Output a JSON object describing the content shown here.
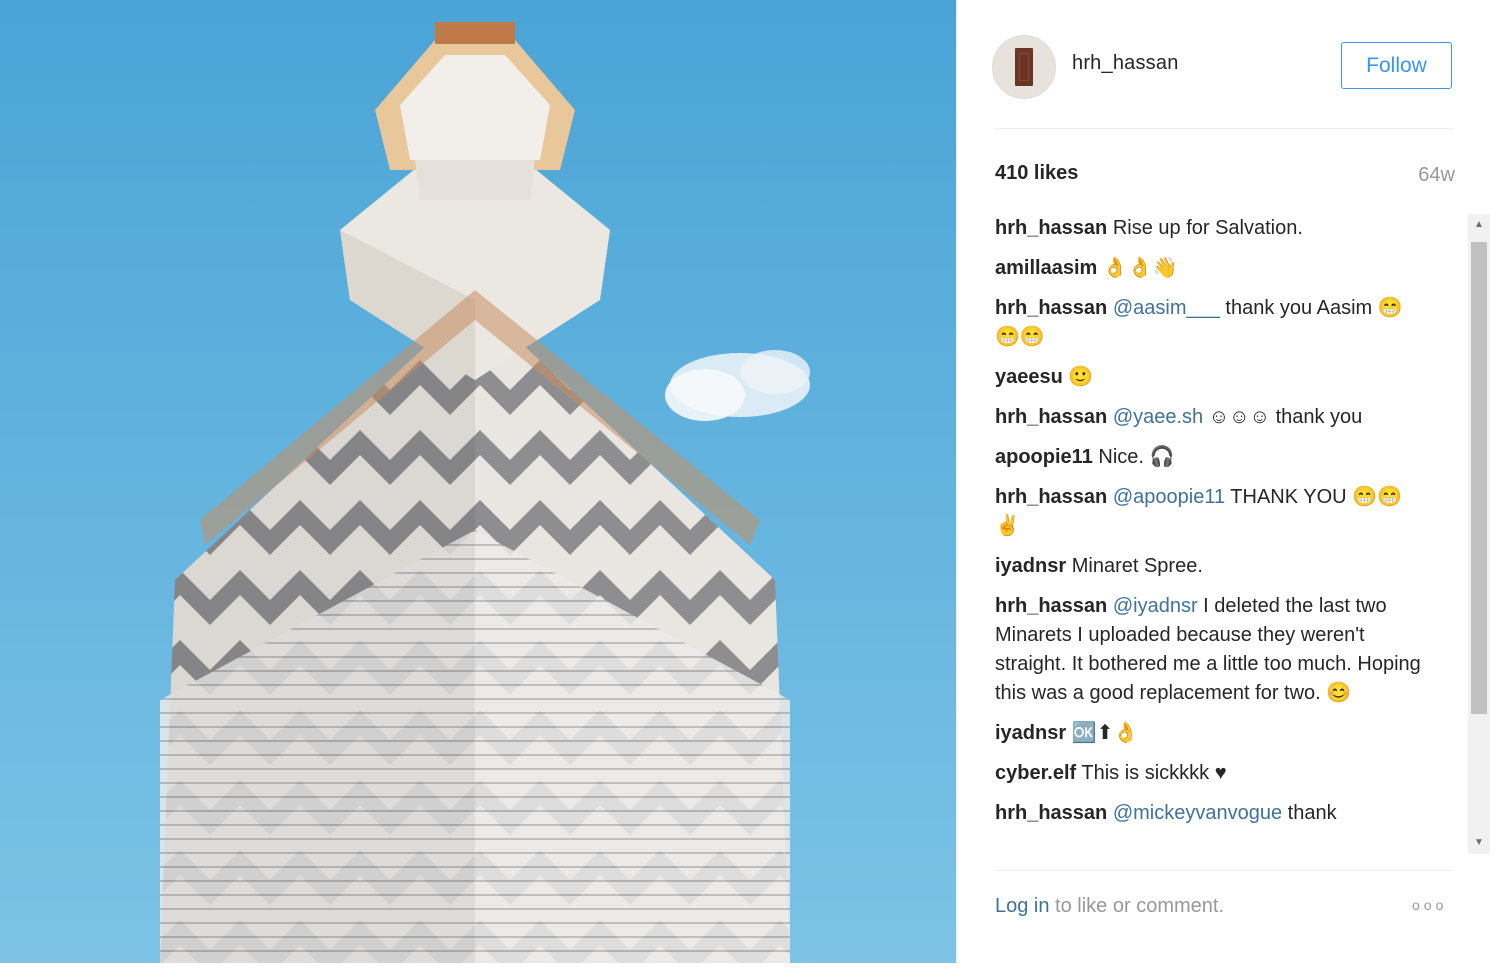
{
  "post": {
    "username": "hrh_hassan",
    "follow_label": "Follow",
    "likes": "410 likes",
    "age": "64w"
  },
  "comments": [
    {
      "user": "hrh_hassan",
      "mention": "",
      "text": "Rise up for Salvation."
    },
    {
      "user": "amillaasim",
      "mention": "",
      "text": "👌👌👋"
    },
    {
      "user": "hrh_hassan",
      "mention": "@aasim___",
      "text": "thank you Aasim 😁😁😁"
    },
    {
      "user": "yaeesu",
      "mention": "",
      "text": "🙂"
    },
    {
      "user": "hrh_hassan",
      "mention": "@yaee.sh",
      "text": "☺☺☺ thank you"
    },
    {
      "user": "apoopie11",
      "mention": "",
      "text": "Nice. 🎧"
    },
    {
      "user": "hrh_hassan",
      "mention": "@apoopie11",
      "text": "THANK YOU 😁😁✌"
    },
    {
      "user": "iyadnsr",
      "mention": "",
      "text": "Minaret Spree."
    },
    {
      "user": "hrh_hassan",
      "mention": "@iyadnsr",
      "text": "I deleted the last two Minarets I uploaded because they weren't straight. It bothered me a little too much. Hoping this was a good replacement for two. 😊"
    },
    {
      "user": "iyadnsr",
      "mention": "",
      "text": "🆗⬆👌"
    },
    {
      "user": "cyber.elf",
      "mention": "",
      "text": "This is sickkkk ♥"
    },
    {
      "user": "hrh_hassan",
      "mention": "@mickeyvanvogue",
      "text": "thank"
    }
  ],
  "footer": {
    "login_link": "Log in",
    "login_text": " to like or comment.",
    "more_label": "ooo"
  },
  "colors": {
    "accent": "#3897f0",
    "mention": "#3f729b",
    "muted": "#999999",
    "sky": "#5aaed9"
  }
}
